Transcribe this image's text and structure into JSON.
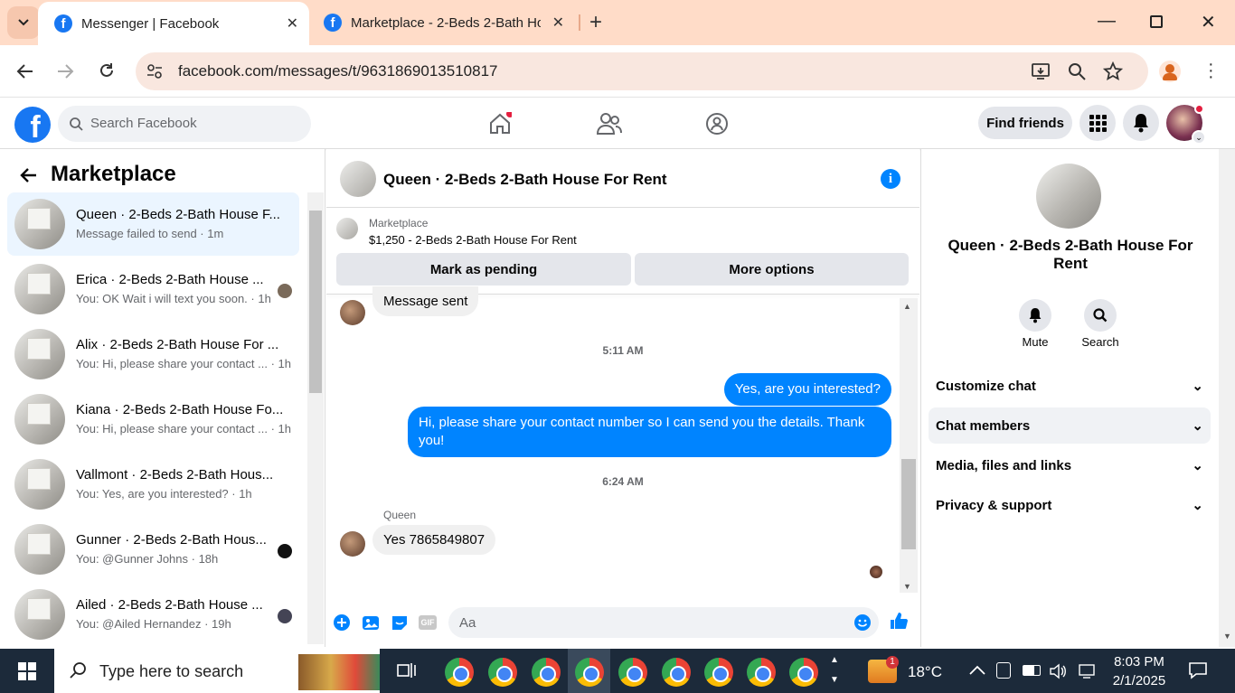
{
  "browser": {
    "tab1_title": "Messenger | Facebook",
    "tab2_title": "Marketplace - 2-Beds 2-Bath Ho",
    "new_tab": "+",
    "url": "facebook.com/messages/t/9631869013510817",
    "fb_glyph": "f"
  },
  "fb_header": {
    "search_placeholder": "Search Facebook",
    "find_friends": "Find friends"
  },
  "left_panel": {
    "title": "Marketplace",
    "conversations": [
      {
        "name": "Queen · 2-Beds 2-Bath House F...",
        "snippet": "Message failed to send · 1m"
      },
      {
        "name": "Erica · 2-Beds 2-Bath House ...",
        "snippet": "You: OK Wait i will text you soon. · 1h"
      },
      {
        "name": "Alix · 2-Beds 2-Bath House For ...",
        "snippet": "You: Hi, please share your contact ... · 1h"
      },
      {
        "name": "Kiana · 2-Beds 2-Bath House Fo...",
        "snippet": "You: Hi, please share your contact ... · 1h"
      },
      {
        "name": "Vallmont · 2-Beds 2-Bath Hous...",
        "snippet": "You: Yes, are you interested? · 1h"
      },
      {
        "name": "Gunner · 2-Beds 2-Bath Hous...",
        "snippet": "You: @Gunner Johns · 18h"
      },
      {
        "name": "Ailed · 2-Beds 2-Bath House ...",
        "snippet": "You: @Ailed Hernandez · 19h"
      }
    ]
  },
  "chat": {
    "title": "Queen · 2-Beds 2-Bath House For Rent",
    "listing_label": "Marketplace",
    "listing_title": "$1,250 - 2-Beds 2-Bath House For Rent",
    "mark_pending": "Mark as pending",
    "more_options": "More options",
    "msg_sent": "Message sent",
    "time1": "5:11 AM",
    "out1": "Yes, are you interested?",
    "out2_line1": "Hi, please share your contact number so I can send you the details. Thank",
    "out2_line2": "you!",
    "time2": "6:24 AM",
    "sender": "Queen",
    "in1": "Yes 7865849807",
    "composer_placeholder": "Aa",
    "gif": "GIF"
  },
  "right_panel": {
    "title_line1": "Queen · 2-Beds 2-Bath House For",
    "title_line2": "Rent",
    "mute": "Mute",
    "search": "Search",
    "sections": [
      "Customize chat",
      "Chat members",
      "Media, files and links",
      "Privacy & support"
    ]
  },
  "taskbar": {
    "search": "Type here to search",
    "temp": "18°C",
    "weather_badge": "1",
    "time": "8:03 PM",
    "date": "2/1/2025"
  },
  "colors": {
    "accent": "#0084ff",
    "fb_blue": "#1877f2",
    "tab_bg": "#ffdcc8"
  }
}
